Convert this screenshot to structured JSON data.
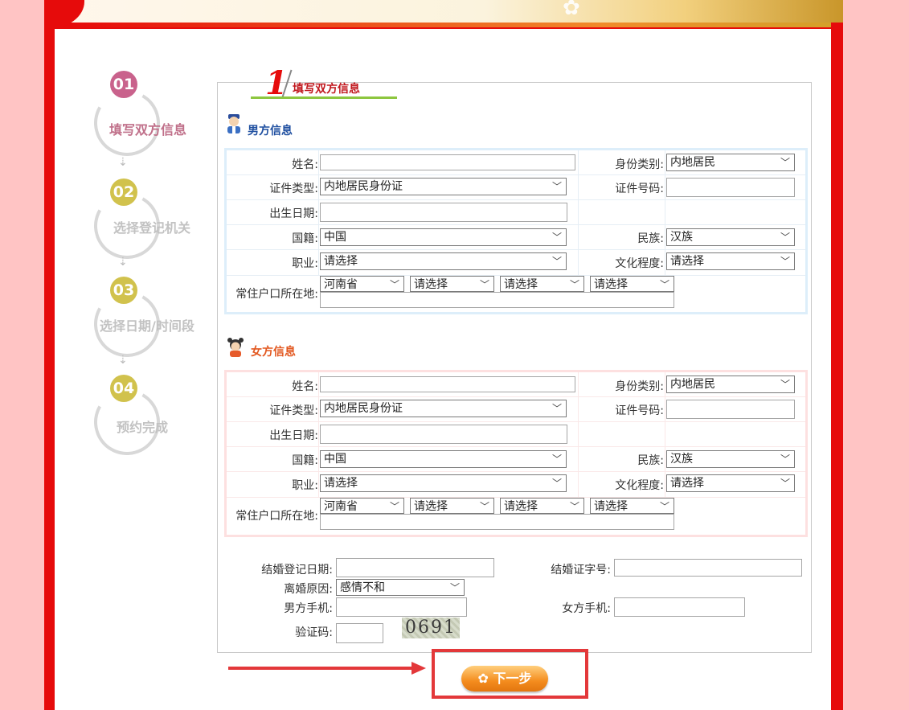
{
  "steps": [
    {
      "num": "01",
      "label": "填写双方信息",
      "color": "#c9628c"
    },
    {
      "num": "02",
      "label": "选择登记机关",
      "color": "#d1c24d"
    },
    {
      "num": "03",
      "label": "选择日期/时间段",
      "color": "#d1c24d"
    },
    {
      "num": "04",
      "label": "预约完成",
      "color": "#d1c24d"
    }
  ],
  "tab": {
    "number": "1",
    "title": "填写双方信息"
  },
  "male": {
    "title": "男方信息",
    "name_label": "姓名:",
    "id_type_label": "身份类别:",
    "id_type_value": "内地居民",
    "cert_type_label": "证件类型:",
    "cert_type_value": "内地居民身份证",
    "cert_no_label": "证件号码:",
    "birth_label": "出生日期:",
    "nationality_label": "国籍:",
    "nationality_value": "中国",
    "ethnic_label": "民族:",
    "ethnic_value": "汉族",
    "job_label": "职业:",
    "job_value": "请选择",
    "edu_label": "文化程度:",
    "edu_value": "请选择",
    "hukou_label": "常住户口所在地:",
    "hukou_province": "河南省",
    "hukou_city": "请选择",
    "hukou_county": "请选择",
    "hukou_town": "请选择"
  },
  "female": {
    "title": "女方信息",
    "name_label": "姓名:",
    "id_type_label": "身份类别:",
    "id_type_value": "内地居民",
    "cert_type_label": "证件类型:",
    "cert_type_value": "内地居民身份证",
    "cert_no_label": "证件号码:",
    "birth_label": "出生日期:",
    "nationality_label": "国籍:",
    "nationality_value": "中国",
    "ethnic_label": "民族:",
    "ethnic_value": "汉族",
    "job_label": "职业:",
    "job_value": "请选择",
    "edu_label": "文化程度:",
    "edu_value": "请选择",
    "hukou_label": "常住户口所在地:",
    "hukou_province": "河南省",
    "hukou_city": "请选择",
    "hukou_county": "请选择",
    "hukou_town": "请选择"
  },
  "extra": {
    "marriage_date_label": "结婚登记日期:",
    "marriage_cert_label": "结婚证字号:",
    "divorce_reason_label": "离婚原因:",
    "divorce_reason_value": "感情不和",
    "male_phone_label": "男方手机:",
    "female_phone_label": "女方手机:",
    "captcha_label": "验证码:",
    "captcha_image_text": "0691"
  },
  "next_button": "下一步",
  "colors": {
    "frame": "#e60b0b",
    "background": "#ffc4c4",
    "male_title": "#1f4fa0",
    "female_title": "#e2571f"
  }
}
